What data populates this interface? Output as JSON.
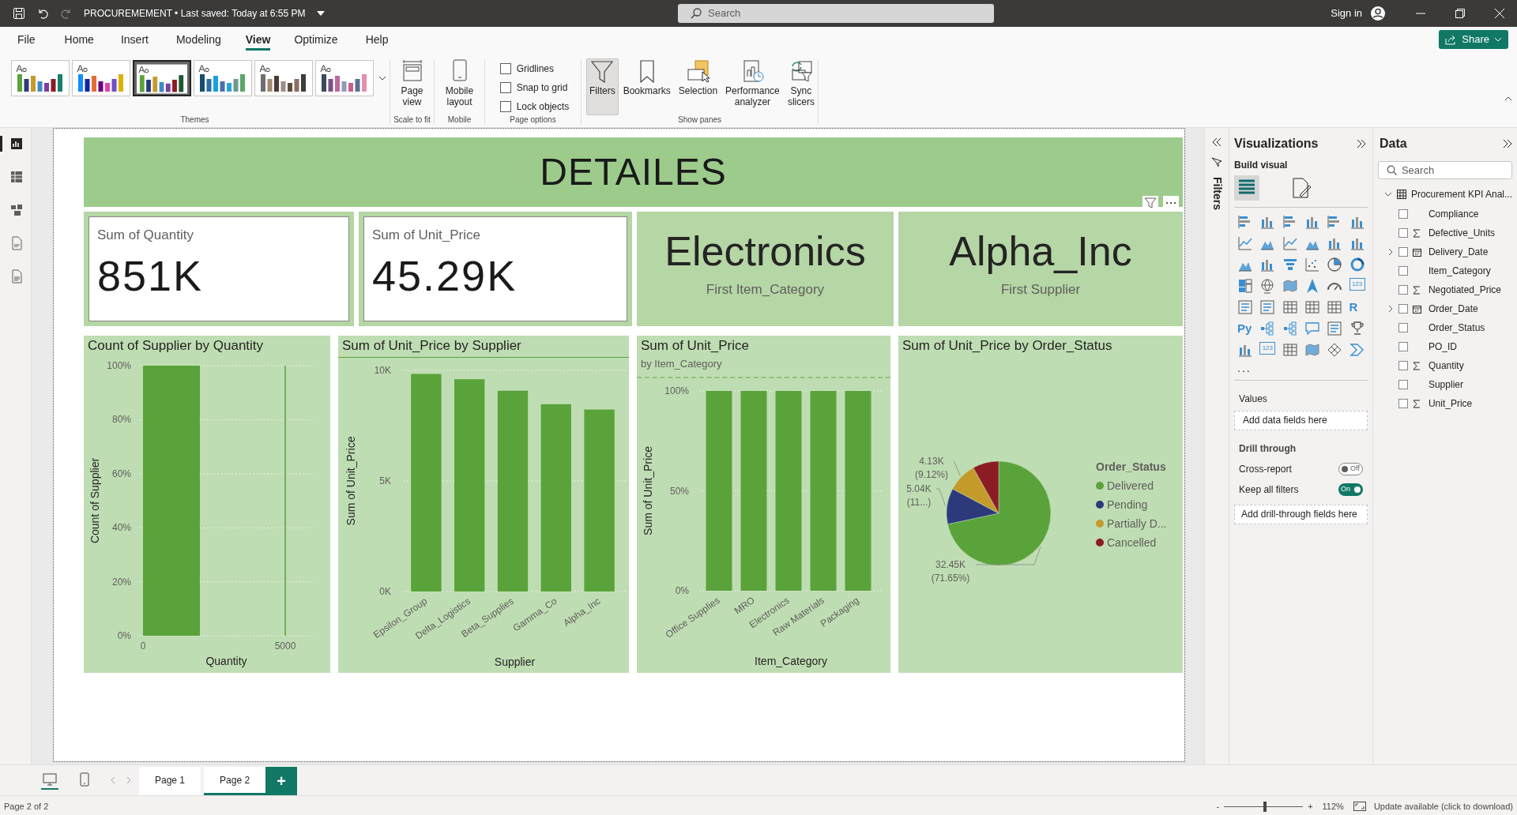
{
  "title_bar": {
    "document_title": "PROCUREMEMENT • Last saved: Today at 6:55 PM",
    "search_placeholder": "Search",
    "sign_in": "Sign in"
  },
  "menu_tabs": [
    {
      "label": "File",
      "selected": false
    },
    {
      "label": "Home",
      "selected": false
    },
    {
      "label": "Insert",
      "selected": false
    },
    {
      "label": "Modeling",
      "selected": false
    },
    {
      "label": "View",
      "selected": true
    },
    {
      "label": "Optimize",
      "selected": false
    },
    {
      "label": "Help",
      "selected": false
    }
  ],
  "share": "Share",
  "ribbon": {
    "themes": [
      {
        "selected": false
      },
      {
        "selected": false
      },
      {
        "selected": true
      },
      {
        "selected": false
      },
      {
        "selected": false
      },
      {
        "selected": false
      }
    ],
    "themes_group": "Themes",
    "page_view": "Page view",
    "scale_group": "Scale to fit",
    "mobile_layout": "Mobile layout",
    "mobile_group": "Mobile",
    "page_options": [
      {
        "label": "Gridlines",
        "checked": false
      },
      {
        "label": "Snap to grid",
        "checked": false
      },
      {
        "label": "Lock objects",
        "checked": false
      }
    ],
    "page_options_group": "Page options",
    "panes": [
      {
        "kind": "filters",
        "label": "Filters",
        "selected": true
      },
      {
        "kind": "bookmarks",
        "label": "Bookmarks",
        "selected": false
      },
      {
        "kind": "selection",
        "label": "Selection",
        "selected": false
      },
      {
        "kind": "performance",
        "label": "Performance analyzer",
        "selected": false
      },
      {
        "kind": "sync",
        "label": "Sync slicers",
        "selected": false
      }
    ],
    "panes_group": "Show panes"
  },
  "left_rail": [
    {
      "kind": "report",
      "selected": true
    },
    {
      "kind": "table",
      "selected": false
    },
    {
      "kind": "model",
      "selected": false
    },
    {
      "kind": "dax",
      "selected": false
    },
    {
      "kind": "tmdl",
      "selected": false
    }
  ],
  "report": {
    "title": "DETAILES",
    "cards": [
      {
        "kind": "kpi",
        "label": "Sum of Quantity",
        "value": "851K"
      },
      {
        "kind": "kpi",
        "label": "Sum of Unit_Price",
        "value": "45.29K"
      },
      {
        "kind": "text",
        "value": "Electronics",
        "label": "First Item_Category"
      },
      {
        "kind": "text",
        "value": "Alpha_Inc",
        "label": "First Supplier"
      }
    ],
    "charts": [
      {
        "title": "Count of Supplier by Quantity",
        "chart_data": {
          "type": "bar",
          "xlabel": "Quantity",
          "ylabel": "Count of Supplier",
          "grid": true,
          "x": [
            1000,
            5000
          ],
          "values": [
            1,
            1
          ],
          "xlim": [
            0,
            6000
          ],
          "ylim": [
            0,
            1
          ],
          "xticks": [
            0,
            5000
          ],
          "yticks": [
            {
              "value": 0,
              "label": "0%"
            },
            {
              "value": 0.2,
              "label": "20%"
            },
            {
              "value": 0.4,
              "label": "40%"
            },
            {
              "value": 0.6,
              "label": "60%"
            },
            {
              "value": 0.8,
              "label": "80%"
            },
            {
              "value": 1,
              "label": "100%"
            }
          ]
        }
      },
      {
        "title": "Sum of Unit_Price by Supplier",
        "chart_data": {
          "type": "bar",
          "grid": true,
          "xlabel": "Supplier",
          "ylabel": "Sum of Unit_Price",
          "categories": [
            "Epsilon_Group",
            "Delta_Logistics",
            "Beta_Supplies",
            "Gamma_Co",
            "Alpha_Inc"
          ],
          "values": [
            9840,
            9600,
            9080,
            8470,
            8230
          ],
          "ylim": [
            0,
            10000
          ],
          "yticks": [
            {
              "value": 0,
              "label": "0K"
            },
            {
              "value": 5000,
              "label": "5K"
            },
            {
              "value": 10000,
              "label": "10K"
            }
          ]
        }
      },
      {
        "title": "Sum of Unit_Price",
        "subtitle": "by Item_Category",
        "chart_data": {
          "type": "bar",
          "grid": true,
          "xlabel": "Item_Category",
          "ylabel": "Sum of Unit_Price",
          "categories": [
            "Office Supplies",
            "MRO",
            "Electronics",
            "Raw Materials",
            "Packaging"
          ],
          "values": [
            1,
            1,
            1,
            1,
            1
          ],
          "ylim": [
            0,
            1
          ],
          "yticks": [
            {
              "value": 0,
              "label": "0%"
            },
            {
              "value": 0.5,
              "label": "50%"
            },
            {
              "value": 1,
              "label": "100%"
            }
          ]
        }
      },
      {
        "title": "Sum of Unit_Price by Order_Status",
        "chart_data": {
          "type": "pie",
          "legend": {
            "title": "Order_Status"
          },
          "categories": [
            "Delivered",
            "Pending",
            "Partially D...",
            "Cancelled"
          ],
          "values": [
            71.65,
            11.13,
            9.12,
            8.1
          ],
          "colors": [
            "#5aa33a",
            "#2c3a7c",
            "#c49a2a",
            "#8c1c24"
          ],
          "value_labels": [
            "32.45K (71.65%)",
            "5.04K (11...)",
            "4.13K (9.12%)",
            null
          ]
        }
      }
    ]
  },
  "filters_pane": {
    "label": "Filters"
  },
  "visualizations": {
    "title": "Visualizations",
    "build_label": "Build visual",
    "build_tabs": [
      {
        "selected": true
      },
      {
        "selected": false
      }
    ],
    "visual_types": [
      {
        "kind": "hbar"
      },
      {
        "kind": "vbar"
      },
      {
        "kind": "hbar"
      },
      {
        "kind": "vbar"
      },
      {
        "kind": "hbar"
      },
      {
        "kind": "vbar"
      },
      {
        "kind": "line"
      },
      {
        "kind": "area"
      },
      {
        "kind": "line"
      },
      {
        "kind": "area"
      },
      {
        "kind": "vbar"
      },
      {
        "kind": "vbar"
      },
      {
        "kind": "area"
      },
      {
        "kind": "vbar"
      },
      {
        "kind": "funnel"
      },
      {
        "kind": "scatter"
      },
      {
        "kind": "pie"
      },
      {
        "kind": "donut"
      },
      {
        "kind": "treemap"
      },
      {
        "kind": "globe"
      },
      {
        "kind": "map"
      },
      {
        "kind": "arrow"
      },
      {
        "kind": "gauge"
      },
      {
        "kind": "card",
        "label": "123"
      },
      {
        "kind": "text"
      },
      {
        "kind": "text"
      },
      {
        "kind": "table"
      },
      {
        "kind": "table"
      },
      {
        "kind": "table"
      },
      {
        "kind": "r",
        "label": "R"
      },
      {
        "kind": "py",
        "label": "Py"
      },
      {
        "kind": "tree"
      },
      {
        "kind": "tree"
      },
      {
        "kind": "speech"
      },
      {
        "kind": "text"
      },
      {
        "kind": "trophy"
      },
      {
        "kind": "vbar"
      },
      {
        "kind": "card",
        "label": "123"
      },
      {
        "kind": "table"
      },
      {
        "kind": "map"
      },
      {
        "kind": "diamond"
      },
      {
        "kind": "chevron"
      }
    ],
    "more": "...",
    "values_label": "Values",
    "values_placeholder": "Add data fields here",
    "drill_label": "Drill through",
    "toggles": [
      {
        "label": "Cross-report",
        "on": false,
        "state_text": "Off"
      },
      {
        "label": "Keep all filters",
        "on": true,
        "state_text": "On"
      }
    ],
    "drill_placeholder": "Add drill-through fields here"
  },
  "data_pane": {
    "title": "Data",
    "search_placeholder": "Search",
    "tree": [
      {
        "label": "Procurement KPI Anal...",
        "expanded": true,
        "children": [
          {
            "label": "Compliance",
            "kind": "text",
            "checked": false
          },
          {
            "label": "Defective_Units",
            "kind": "sum",
            "checked": false
          },
          {
            "label": "Delivery_Date",
            "kind": "date",
            "checked": false,
            "expanded": false
          },
          {
            "label": "Item_Category",
            "kind": "text",
            "checked": false
          },
          {
            "label": "Negotiated_Price",
            "kind": "sum",
            "checked": false
          },
          {
            "label": "Order_Date",
            "kind": "date",
            "checked": false,
            "expanded": false
          },
          {
            "label": "Order_Status",
            "kind": "text",
            "checked": false
          },
          {
            "label": "PO_ID",
            "kind": "text",
            "checked": false
          },
          {
            "label": "Quantity",
            "kind": "sum",
            "checked": false
          },
          {
            "label": "Supplier",
            "kind": "text",
            "checked": false
          },
          {
            "label": "Unit_Price",
            "kind": "sum",
            "checked": false
          }
        ]
      }
    ]
  },
  "page_tabs": [
    {
      "label": "Page 1",
      "selected": false
    },
    {
      "label": "Page 2",
      "selected": true
    }
  ],
  "add_page": "+",
  "view_modes": [
    {
      "kind": "desktop",
      "selected": true
    },
    {
      "kind": "mobile",
      "selected": false
    }
  ],
  "status_bar": {
    "page": "Page 2 of 2",
    "zoom_minus": "-",
    "zoom_plus": "+",
    "zoom": {
      "level": 0.52
    },
    "zoom_text": "112%",
    "update": "Update available (click to download)"
  }
}
